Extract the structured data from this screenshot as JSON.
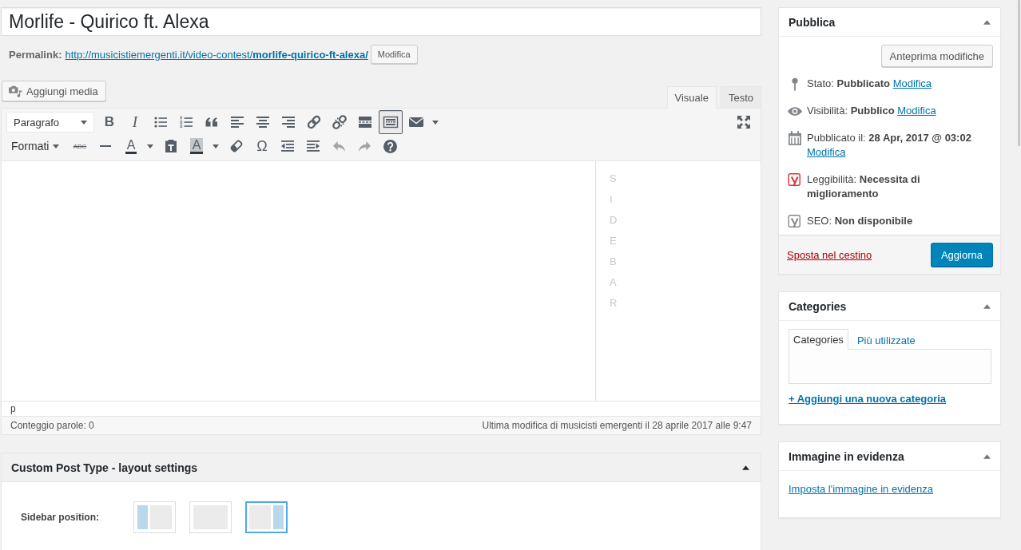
{
  "title_field": {
    "value": "Morlife - Quirico ft. Alexa"
  },
  "permalink": {
    "label": "Permalink:",
    "url": "http://musicistiemergenti.it/video-contest/**morlife-quirico-ft-alexa/**",
    "edit_button": "Modifica"
  },
  "editor": {
    "add_media_button": "Aggiungi media",
    "tabs": [
      {
        "label": "Visuale",
        "selected": true
      },
      {
        "label": "Testo",
        "selected": false
      }
    ],
    "toolbar": {
      "row_1": [
        {
          "kind": "paragraph-select",
          "label": "Paragrafo",
          "active": false,
          "disabled": false
        },
        {
          "kind": "bold",
          "text": "B",
          "active": false,
          "disabled": false
        },
        {
          "kind": "italic",
          "text": "I",
          "active": false,
          "disabled": false
        },
        {
          "kind": "bullet-list",
          "active": false,
          "disabled": false
        },
        {
          "kind": "numbered-list",
          "active": false,
          "disabled": false
        },
        {
          "kind": "blockquote",
          "active": false,
          "disabled": false
        },
        {
          "kind": "align-left",
          "active": false,
          "disabled": false
        },
        {
          "kind": "align-center",
          "active": false,
          "disabled": false
        },
        {
          "kind": "align-right",
          "active": false,
          "disabled": false
        },
        {
          "kind": "link",
          "active": false,
          "disabled": false
        },
        {
          "kind": "unlink",
          "active": false,
          "disabled": false
        },
        {
          "kind": "read-more",
          "active": false,
          "disabled": false
        },
        {
          "kind": "toolbar-toggle",
          "active": true,
          "disabled": false
        },
        {
          "kind": "mail",
          "active": false,
          "disabled": false
        },
        {
          "kind": "fullscreen",
          "active": false,
          "disabled": false
        }
      ],
      "row_2": [
        {
          "kind": "formats",
          "label": "Formati",
          "active": false,
          "disabled": false
        },
        {
          "kind": "strikethrough",
          "text": "ABC",
          "active": false,
          "disabled": false
        },
        {
          "kind": "horizontal-line",
          "active": false,
          "disabled": false
        },
        {
          "kind": "text-color",
          "text": "A",
          "active": false,
          "disabled": false
        },
        {
          "kind": "paste-text",
          "active": false,
          "disabled": false
        },
        {
          "kind": "background-color",
          "text": "A",
          "active": false,
          "disabled": false
        },
        {
          "kind": "clear-formatting",
          "active": false,
          "disabled": false
        },
        {
          "kind": "special-character",
          "text": "Ω",
          "active": false,
          "disabled": false
        },
        {
          "kind": "outdent",
          "active": false,
          "disabled": false
        },
        {
          "kind": "indent",
          "active": false,
          "disabled": false
        },
        {
          "kind": "undo",
          "active": false,
          "disabled": true
        },
        {
          "kind": "redo",
          "active": false,
          "disabled": true
        },
        {
          "kind": "help",
          "active": false,
          "disabled": false
        }
      ]
    },
    "sidebar_label": "SIDEBAR",
    "path": "p",
    "word_count": "Conteggio parole: 0",
    "last_edit": "Ultima modifica di musicisti emergenti il 28 aprile 2017 alle 9:47"
  },
  "layout_box": {
    "title": "Custom Post Type - layout settings",
    "expanded": true,
    "label": "Sidebar position:",
    "options": [
      {
        "kind": "left-sidebar",
        "selected": false
      },
      {
        "kind": "no-sidebar",
        "selected": false
      },
      {
        "kind": "right-sidebar",
        "selected": true
      }
    ]
  },
  "publish_box": {
    "title": "Pubblica",
    "expanded": true,
    "preview_button": "Anteprima modifiche",
    "rows": [
      {
        "kind": "status",
        "text": "Stato: **Pubblicato**",
        "link": "Modifica"
      },
      {
        "kind": "visibility",
        "text": "Visibilità: **Pubblico**",
        "link": "Modifica"
      },
      {
        "kind": "date",
        "text": "Pubblicato il: **28 Apr, 2017 @ 03:02**",
        "link": "Modifica"
      },
      {
        "kind": "readability",
        "text": "Leggibilità: **Necessita di miglioramento**",
        "color": "#dc3232"
      },
      {
        "kind": "seo",
        "text": "SEO: **Non disponibile**",
        "color": "#888888"
      }
    ],
    "trash_link": "Sposta nel cestino",
    "update_button": "Aggiorna"
  },
  "categories_box": {
    "title": "Categories",
    "expanded": true,
    "tabs": [
      {
        "label": "Categories",
        "selected": true
      },
      {
        "label": "Più utilizzate",
        "selected": false
      }
    ],
    "add_link": "+ Aggiungi una nuova categoria"
  },
  "featured_image_box": {
    "title": "Immagine in evidenza",
    "expanded": true,
    "link": "Imposta l'immagine in evidenza"
  }
}
